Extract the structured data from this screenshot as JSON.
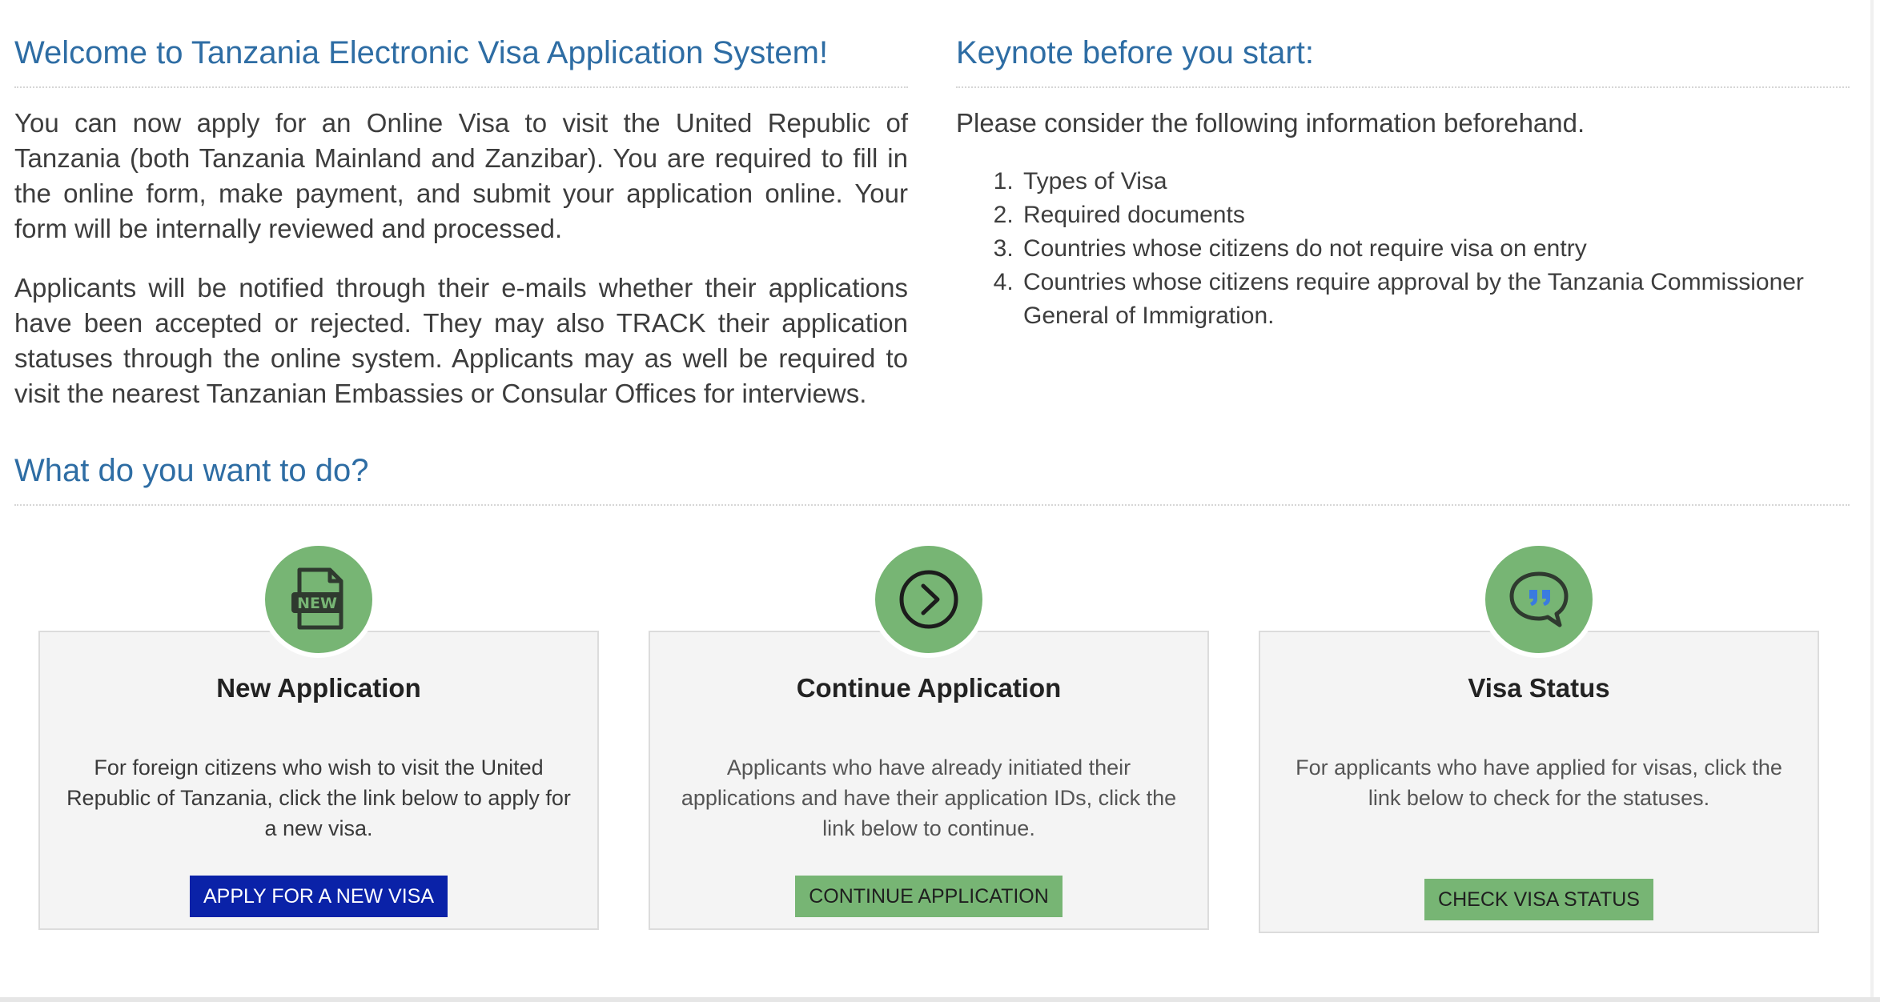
{
  "welcome": {
    "title": "Welcome to Tanzania Electronic Visa Application System!",
    "paragraphs": [
      "You can now apply for an Online Visa to visit the United Republic of Tanzania (both Tanzania Mainland and Zanzibar). You are required to fill in the online form, make payment, and submit your application online. Your form will be internally reviewed and processed.",
      "Applicants will be notified through their e-mails whether their applications have been accepted or rejected. They may also TRACK their application statuses through the online system. Applicants may as well be required to visit the nearest Tanzanian Embassies or Consular Offices for interviews."
    ]
  },
  "keynote": {
    "title": "Keynote before you start:",
    "intro": "Please consider the following information beforehand.",
    "items": [
      "Types of Visa",
      "Required documents",
      "Countries whose citizens do not require visa on entry",
      "Countries whose citizens require approval by the Tanzania Commissioner General of Immigration."
    ]
  },
  "actions": {
    "title": "What do you want to do?",
    "cards": [
      {
        "icon": "new-document-icon",
        "icon_text": "NEW",
        "title": "New Application",
        "description": "For foreign citizens who wish to visit the United Republic of Tanzania, click the link below to apply for a new visa.",
        "button": "APPLY FOR A NEW VISA"
      },
      {
        "icon": "chevron-right-circle-icon",
        "title": "Continue Application",
        "description": "Applicants who have already initiated their applications and have their application IDs, click the link below to continue.",
        "button": "CONTINUE APPLICATION"
      },
      {
        "icon": "quote-chat-icon",
        "title": "Visa Status",
        "description": "For applicants who have applied for visas, click the link below to check for the statuses.",
        "button": "CHECK VISA STATUS"
      }
    ]
  },
  "colors": {
    "heading_blue": "#2e6da4",
    "icon_green": "#77b574",
    "primary_button": "#0a22a8"
  }
}
